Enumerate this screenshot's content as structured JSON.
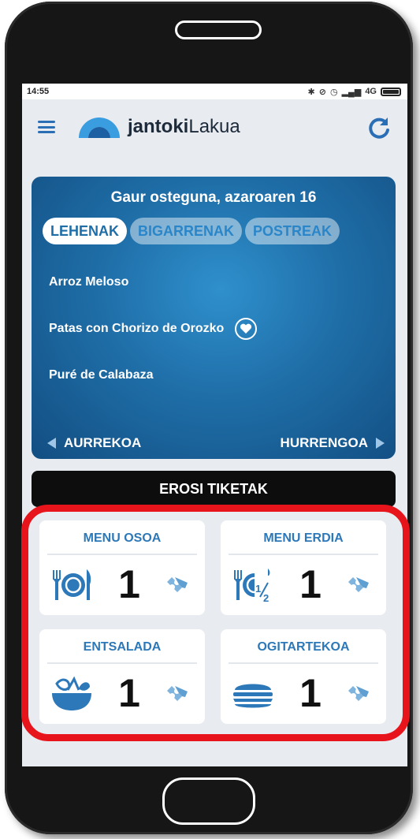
{
  "status_bar": {
    "time": "14:55",
    "network": "4G"
  },
  "app": {
    "brand_bold": "jantoki",
    "brand_light": "Lakua"
  },
  "menu": {
    "date": "Gaur osteguna, azaroaren 16",
    "tabs": [
      {
        "label": "LEHENAK",
        "active": true
      },
      {
        "label": "BIGARRENAK",
        "active": false
      },
      {
        "label": "POSTREAK",
        "active": false
      }
    ],
    "dishes": [
      {
        "name": "Arroz Meloso",
        "favorite": false
      },
      {
        "name": "Patas con Chorizo de Orozko",
        "favorite": true
      },
      {
        "name": "Puré de Calabaza",
        "favorite": false
      }
    ],
    "prev_label": "AURREKOA",
    "next_label": "HURRENGOA"
  },
  "buy": {
    "label": "EROSI TIKETAK"
  },
  "tickets": [
    {
      "title": "MENU OSOA",
      "count": "1",
      "icon": "plate-utensils-icon"
    },
    {
      "title": "MENU ERDIA",
      "count": "1",
      "icon": "half-plate-icon"
    },
    {
      "title": "ENTSALADA",
      "count": "1",
      "icon": "salad-bowl-icon"
    },
    {
      "title": "OGITARTEKOA",
      "count": "1",
      "icon": "sandwich-icon"
    }
  ],
  "colors": {
    "accent": "#2c78b8",
    "card_gradient_start": "#2f90cc",
    "card_gradient_end": "#124e82",
    "highlight": "#e8141c"
  }
}
